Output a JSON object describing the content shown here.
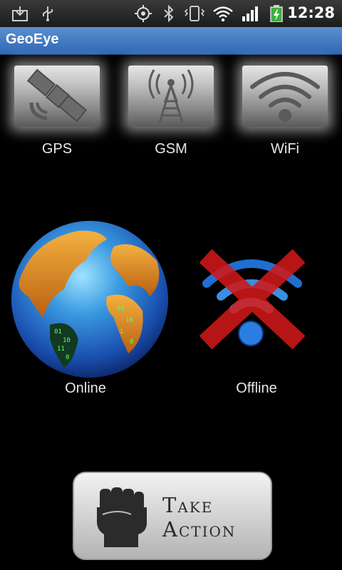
{
  "status_bar": {
    "time": "12:28",
    "icons": [
      "download-icon",
      "usb-icon",
      "gps-icon",
      "bluetooth-icon",
      "vibrate-icon",
      "wifi-icon",
      "signal-icon",
      "battery-charging-icon"
    ]
  },
  "app": {
    "title": "GeoEye"
  },
  "sensors": [
    {
      "label": "GPS",
      "icon": "satellite-icon"
    },
    {
      "label": "GSM",
      "icon": "cell-tower-icon"
    },
    {
      "label": "WiFi",
      "icon": "wifi-icon"
    }
  ],
  "states": [
    {
      "label": "Online",
      "icon": "globe-icon"
    },
    {
      "label": "Offline",
      "icon": "wifi-crossed-icon"
    }
  ],
  "action": {
    "line1": "Take",
    "line2": "Action",
    "icon": "fist-icon"
  },
  "colors": {
    "titlebar": "#3f78c2",
    "offline_cross": "#d01818",
    "wifi_blue": "#3a8fe0"
  }
}
